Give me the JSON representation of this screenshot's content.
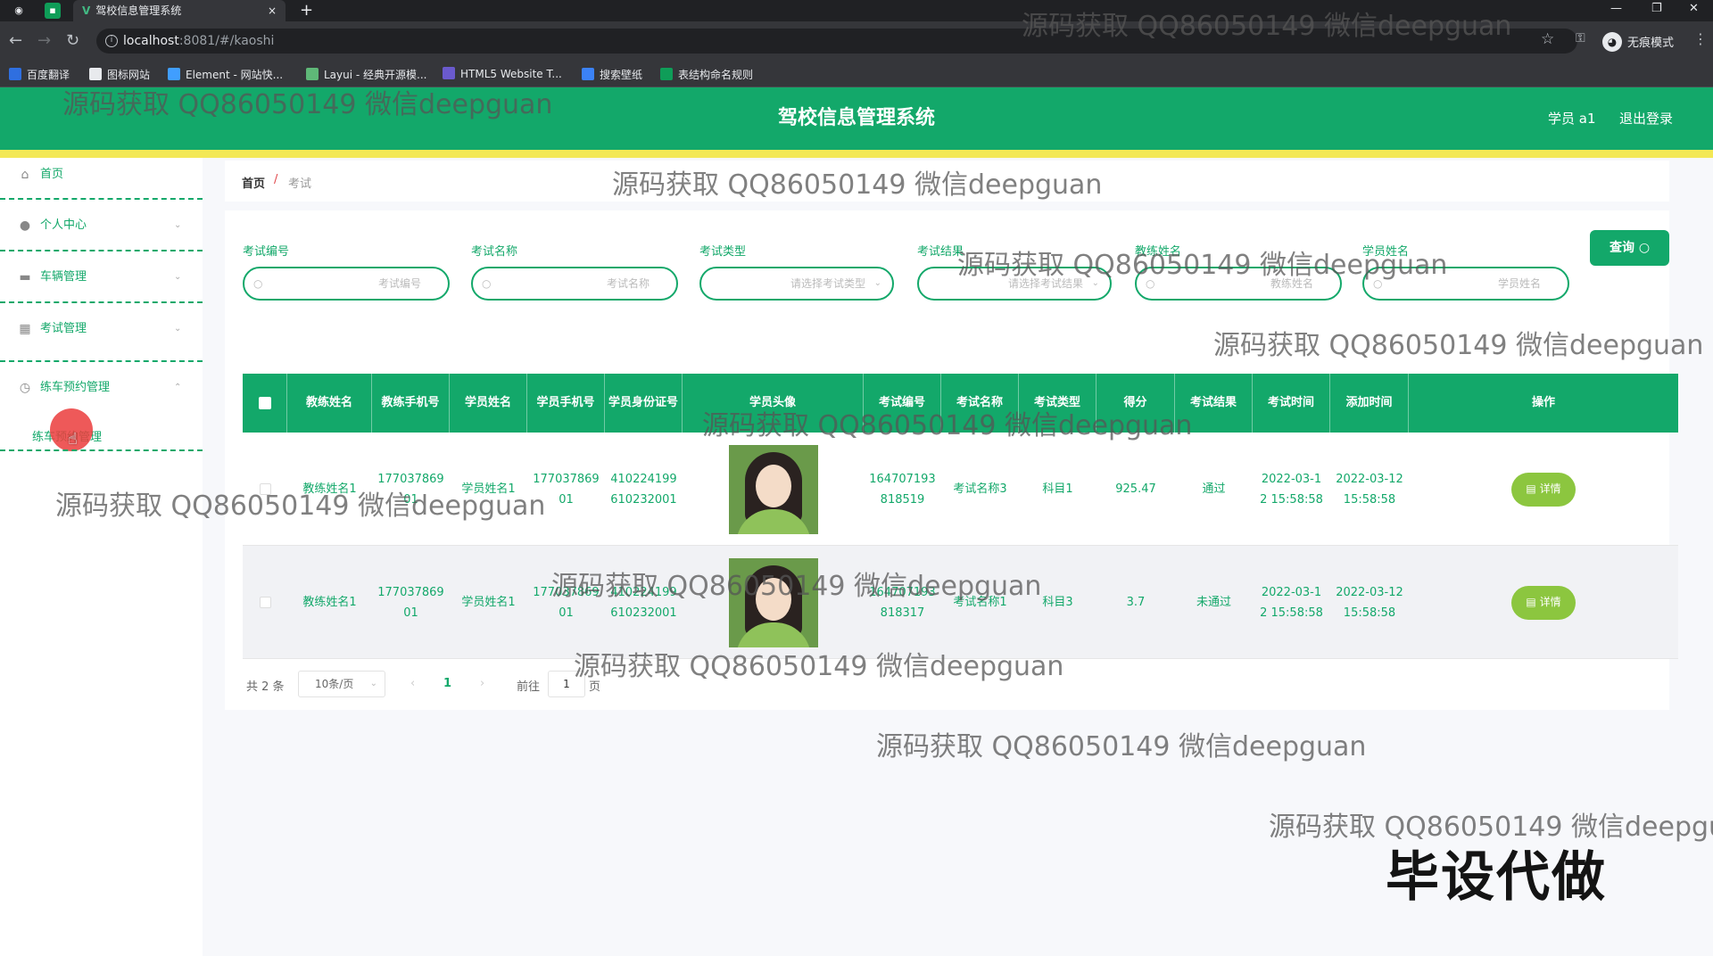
{
  "browser": {
    "tab_title": "驾校信息管理系统",
    "tab_close": "×",
    "new_tab": "+",
    "url_host": "localhost",
    "url_path": ":8081/#/kaoshi",
    "incognito_label": "无痕模式",
    "bookmarks": [
      "百度翻译",
      "图标网站",
      "Element - 网站快...",
      "Layui - 经典开源模...",
      "HTML5 Website T...",
      "搜索壁纸",
      "表结构命名规则"
    ]
  },
  "header": {
    "title": "驾校信息管理系统",
    "user": "学员 a1",
    "logout": "退出登录"
  },
  "sidebar": {
    "items": [
      {
        "label": "首页",
        "icon": "home-icon"
      },
      {
        "label": "个人中心",
        "icon": "user-icon"
      },
      {
        "label": "车辆管理",
        "icon": "briefcase-icon"
      },
      {
        "label": "考试管理",
        "icon": "grid-icon"
      },
      {
        "label": "练车预约管理",
        "icon": "clock-icon"
      }
    ],
    "sub_item": "练车预约管理"
  },
  "breadcrumb": {
    "home": "首页",
    "separator": "/",
    "current": "考试"
  },
  "filters": [
    {
      "label": "考试编号",
      "placeholder": "考试编号",
      "type": "input"
    },
    {
      "label": "考试名称",
      "placeholder": "考试名称",
      "type": "input"
    },
    {
      "label": "考试类型",
      "placeholder": "请选择考试类型",
      "type": "select"
    },
    {
      "label": "考试结果",
      "placeholder": "请选择考试结果",
      "type": "select"
    },
    {
      "label": "教练姓名",
      "placeholder": "教练姓名",
      "type": "input"
    },
    {
      "label": "学员姓名",
      "placeholder": "学员姓名",
      "type": "input"
    }
  ],
  "query_button": "查询",
  "table": {
    "headers": [
      "教练姓名",
      "教练手机号",
      "学员姓名",
      "学员手机号",
      "学员身份证号",
      "学员头像",
      "考试编号",
      "考试名称",
      "考试类型",
      "得分",
      "考试结果",
      "考试时间",
      "添加时间",
      "操作"
    ],
    "rows": [
      {
        "coach_name": "教练姓名1",
        "coach_phone": "17703786901",
        "student_name": "学员姓名1",
        "student_phone": "17703786901",
        "id_card": "410224199610232001",
        "exam_no": "164707193818519",
        "exam_name": "考试名称3",
        "exam_type": "科目1",
        "score": "925.47",
        "result": "通过",
        "exam_time": "2022-03-12 15:58:58",
        "add_time": "2022-03-12 15:58:58",
        "action": "详情"
      },
      {
        "coach_name": "教练姓名1",
        "coach_phone": "17703786901",
        "student_name": "学员姓名1",
        "student_phone": "17703786901",
        "id_card": "410224199610232001",
        "exam_no": "164707193818317",
        "exam_name": "考试名称1",
        "exam_type": "科目3",
        "score": "3.7",
        "result": "未通过",
        "exam_time": "2022-03-12 15:58:58",
        "add_time": "2022-03-12 15:58:58",
        "action": "详情"
      }
    ]
  },
  "pagination": {
    "total": "共 2 条",
    "page_size": "10条/页",
    "current": "1",
    "goto_label": "前往",
    "goto_value": "1",
    "page_suffix": "页"
  },
  "watermark": "源码获取 QQ86050149 微信deepguan",
  "watermark_cut": "源码获取 QQ86050149 微信deepgu",
  "stamp": "毕设代做"
}
